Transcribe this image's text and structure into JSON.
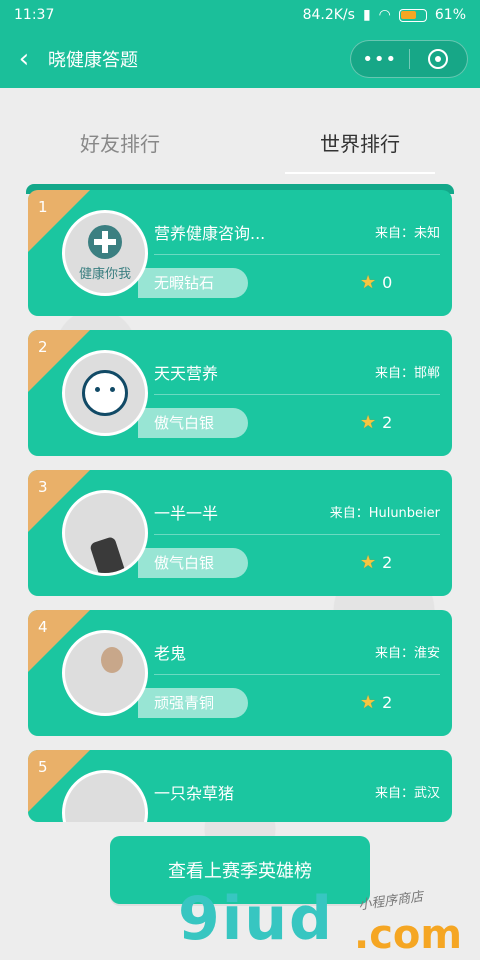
{
  "statusbar": {
    "time": "11:37",
    "speed": "84.2K/s",
    "battery": "61%"
  },
  "navbar": {
    "title": "晓健康答题",
    "more_glyph": "•••"
  },
  "tabs": [
    {
      "label": "好友排行",
      "active": false
    },
    {
      "label": "世界排行",
      "active": true
    }
  ],
  "ranking": [
    {
      "rank": "1",
      "name": "营养健康咨询...",
      "from": "来自：未知",
      "level": "无暇钻石",
      "score": "0",
      "avatar_text": "健康你我"
    },
    {
      "rank": "2",
      "name": "天天营养",
      "from": "来自：邯郸",
      "level": "傲气白银",
      "score": "2"
    },
    {
      "rank": "3",
      "name": "一半一半",
      "from": "来自：Hulunbeier",
      "level": "傲气白银",
      "score": "2"
    },
    {
      "rank": "4",
      "name": "老鬼",
      "from": "来自：淮安",
      "level": "顽强青铜",
      "score": "2"
    },
    {
      "rank": "5",
      "name": "一只杂草猪",
      "from": "来自：武汉",
      "level": "",
      "score": ""
    }
  ],
  "hero_button": {
    "label": "查看上赛季英雄榜"
  },
  "watermark": {
    "big": "9iud",
    "com": ".com",
    "small": "小程序商店"
  },
  "colors": {
    "primary": "#1bbf9a",
    "card": "#1bc6a0",
    "corner": "#e9b069"
  },
  "icons": {
    "back": "back-chevron-icon",
    "star": "star-icon",
    "close": "capsule-close-icon"
  }
}
